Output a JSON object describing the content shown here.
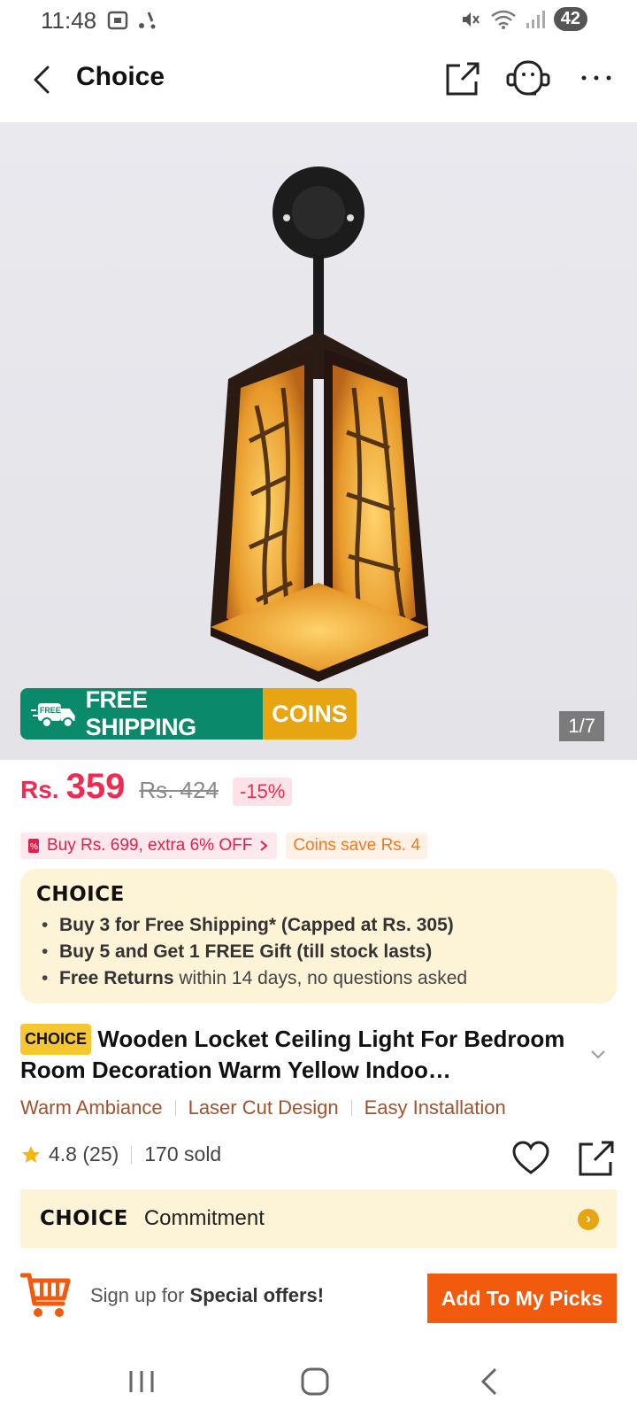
{
  "status": {
    "time": "11:48",
    "battery": "42"
  },
  "header": {
    "title": "Choice"
  },
  "hero": {
    "free_shipping": "FREE SHIPPING",
    "coins": "COINS",
    "free_tag": "FREE",
    "counter": "1/7"
  },
  "price": {
    "currency": "Rs.",
    "value": "359",
    "old": "Rs. 424",
    "discount": "-15%"
  },
  "promos": {
    "extra": "Buy Rs. 699, extra 6% OFF",
    "coins": "Coins save Rs. 4"
  },
  "choice": {
    "logo": "CHOICE",
    "bullet1": "Buy 3 for  Free Shipping* (Capped at Rs. 305)",
    "bullet2": "Buy 5 and Get 1 FREE Gift (till stock lasts)",
    "bullet3_bold": "Free Returns",
    "bullet3_rest": " within 14 days, no questions asked"
  },
  "product": {
    "tag": "CHOICE",
    "title": "Wooden Locket Ceiling Light For Bedroom Room Decoration Warm Yellow Indoo…",
    "features": [
      "Warm Ambiance",
      "Laser Cut Design",
      "Easy Installation"
    ],
    "rating": "4.8 (25)",
    "sold": "170 sold"
  },
  "commitment": {
    "logo": "CHOICE",
    "label": "Commitment"
  },
  "bottom": {
    "signup_prefix": "Sign up for ",
    "signup_bold": "Special offers!",
    "add_button": "Add To My Picks"
  },
  "colors": {
    "price": "#ef2b52",
    "accent": "#f25a0d",
    "choice_bg": "#fdf3d6"
  }
}
